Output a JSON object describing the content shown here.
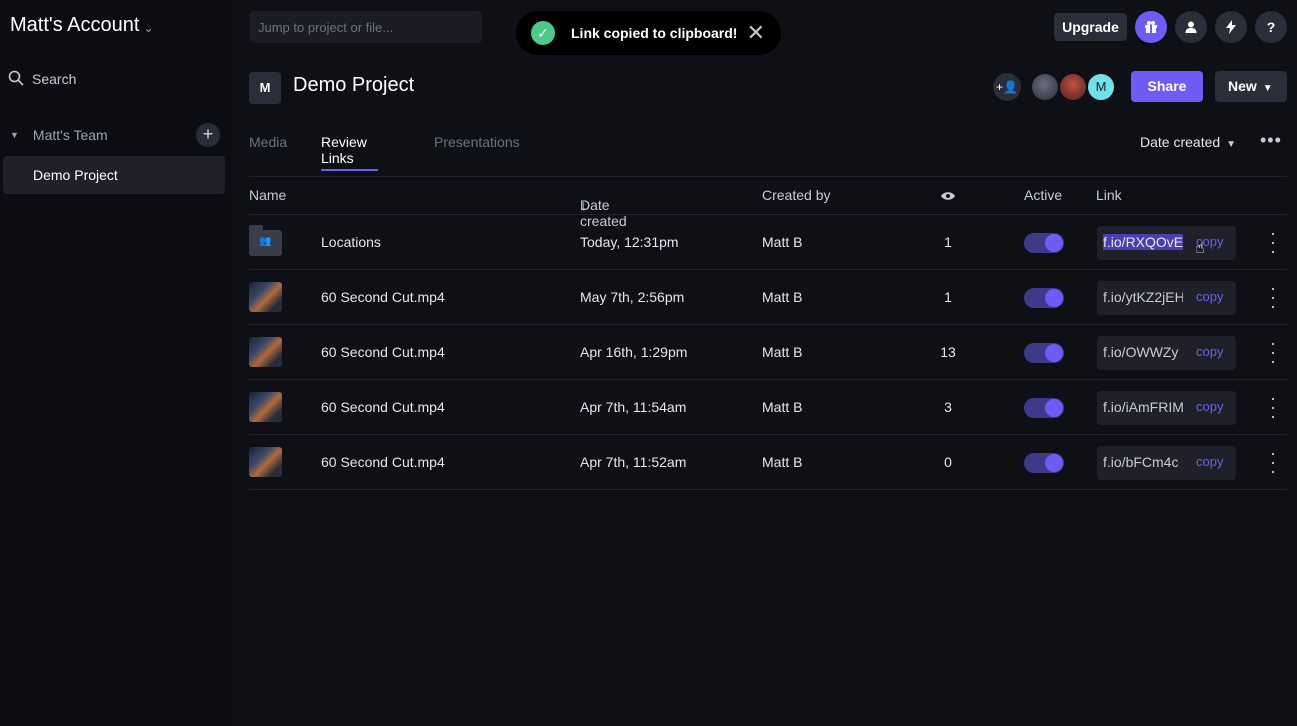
{
  "sidebar": {
    "account_name": "Matt's Account",
    "search_label": "Search",
    "team_name": "Matt's Team",
    "project_name": "Demo Project"
  },
  "topbar": {
    "jump_placeholder": "Jump to project or file...",
    "toast_message": "Link copied to clipboard!",
    "upgrade_label": "Upgrade",
    "help_label": "?"
  },
  "project": {
    "avatar_letter": "M",
    "title": "Demo Project",
    "member_initial": "M",
    "share_label": "Share",
    "new_label": "New"
  },
  "tabs": [
    {
      "label": "Media",
      "active": false
    },
    {
      "label": "Review Links",
      "active": true
    },
    {
      "label": "Presentations",
      "active": false
    }
  ],
  "sort_label": "Date created",
  "table": {
    "headers": {
      "name": "Name",
      "date": "Date created",
      "sort_arrow": "↓",
      "created_by": "Created by",
      "views_icon": "eye-icon",
      "active": "Active",
      "link": "Link"
    },
    "copy_label": "copy",
    "rows": [
      {
        "name": "Locations",
        "type": "folder",
        "date": "Today, 12:31pm",
        "created_by": "Matt B",
        "views": "1",
        "active": true,
        "link": "f.io/RXQOvE",
        "selected": true
      },
      {
        "name": "60 Second Cut.mp4",
        "type": "video",
        "date": "May 7th, 2:56pm",
        "created_by": "Matt B",
        "views": "1",
        "active": true,
        "link": "f.io/ytKZ2jEH",
        "selected": false
      },
      {
        "name": "60 Second Cut.mp4",
        "type": "video",
        "date": "Apr 16th, 1:29pm",
        "created_by": "Matt B",
        "views": "13",
        "active": true,
        "link": "f.io/OWWZy",
        "selected": false
      },
      {
        "name": "60 Second Cut.mp4",
        "type": "video",
        "date": "Apr 7th, 11:54am",
        "created_by": "Matt B",
        "views": "3",
        "active": true,
        "link": "f.io/iAmFRIM",
        "selected": false
      },
      {
        "name": "60 Second Cut.mp4",
        "type": "video",
        "date": "Apr 7th, 11:52am",
        "created_by": "Matt B",
        "views": "0",
        "active": true,
        "link": "f.io/bFCm4c",
        "selected": false
      }
    ]
  },
  "colors": {
    "accent": "#6f5cf6",
    "background": "#0f1016",
    "success": "#4ec98a"
  }
}
